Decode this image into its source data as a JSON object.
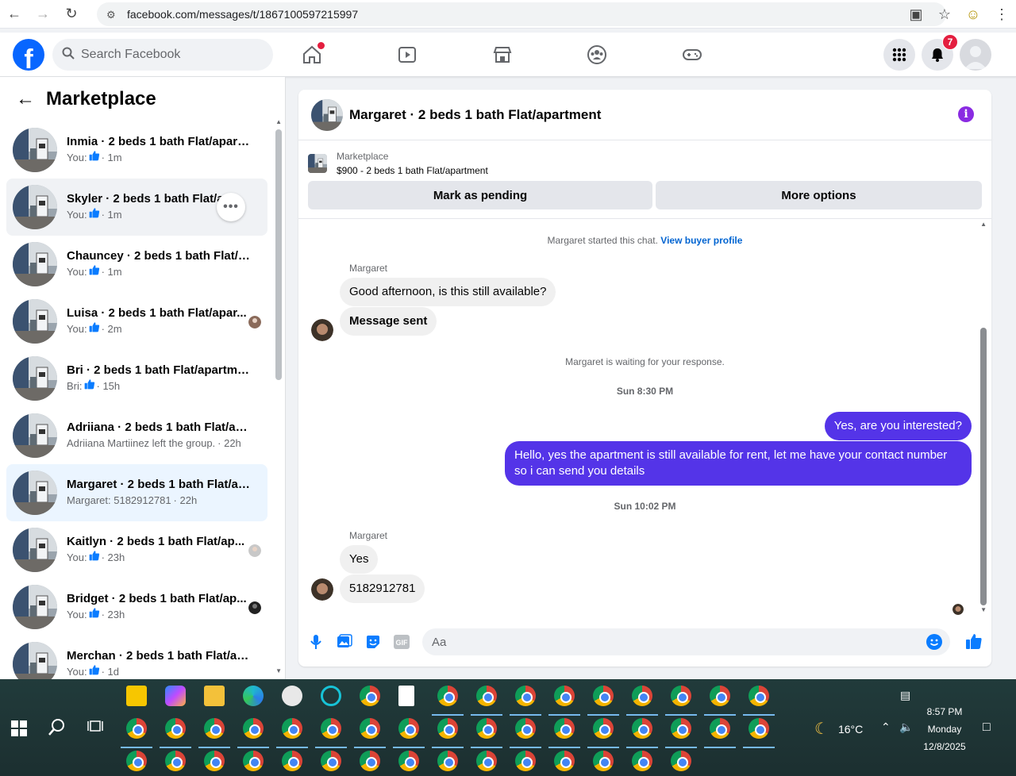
{
  "browser": {
    "url": "facebook.com/messages/t/1867100597215997"
  },
  "header": {
    "search_placeholder": "Search Facebook",
    "notification_count": "7"
  },
  "sidebar": {
    "title": "Marketplace",
    "conversations": [
      {
        "title": "Inmia · 2 beds 1 bath Flat/apart...",
        "prefix": "You:",
        "time": "· 1m",
        "like": true
      },
      {
        "title": "Skyler · 2 beds 1 bath Flat/ap...",
        "prefix": "You:",
        "time": "· 1m",
        "like": true
      },
      {
        "title": "Chauncey · 2 beds 1 bath Flat/ap...",
        "prefix": "You:",
        "time": "· 1m",
        "like": true
      },
      {
        "title": "Luisa · 2 beds 1 bath Flat/apar...",
        "prefix": "You:",
        "time": "· 2m",
        "like": true
      },
      {
        "title": "Bri · 2 beds 1 bath Flat/apartment",
        "prefix": "Bri:",
        "time": "· 15h",
        "like": true
      },
      {
        "title": "Adriiana · 2 beds 1 bath Flat/apa...",
        "prefix": "Adriiana Martiinez left the group.",
        "time": "· 22h",
        "like": false
      },
      {
        "title": "Margaret · 2 beds 1 bath Flat/ap...",
        "prefix": "Margaret: 5182912781",
        "time": "· 22h",
        "like": false
      },
      {
        "title": "Kaitlyn · 2 beds 1 bath Flat/ap...",
        "prefix": "You:",
        "time": "· 23h",
        "like": true
      },
      {
        "title": "Bridget · 2 beds 1 bath Flat/ap...",
        "prefix": "You:",
        "time": "· 23h",
        "like": true
      },
      {
        "title": "Merchan · 2 beds 1 bath Flat/ap...",
        "prefix": "You:",
        "time": "· 1d",
        "like": true
      }
    ]
  },
  "chat": {
    "title": "Margaret · 2 beds 1 bath Flat/apartment",
    "listing_source": "Marketplace",
    "listing_title": "$900 - 2 beds 1 bath Flat/apartment",
    "mark_pending_label": "Mark as pending",
    "more_options_label": "More options",
    "started_text": "Margaret started this chat.",
    "view_profile_label": "View buyer profile",
    "sender_name": "Margaret",
    "msg_1": "Good afternoon, is this still available?",
    "msg_2": "Message sent",
    "waiting_text": "Margaret is waiting for your response.",
    "time_1": "Sun 8:30 PM",
    "out_1": "Yes, are you interested?",
    "out_2": "Hello, yes the apartment is still available for rent, let me have your contact number so i can send you details",
    "time_2": "Sun 10:02 PM",
    "msg_3": "Yes",
    "msg_4": "5182912781",
    "composer_placeholder": "Aa"
  },
  "taskbar": {
    "temperature": "16°C",
    "time": "8:57 PM",
    "day": "Monday",
    "date": "12/8/2025"
  },
  "colors": {
    "fb_blue": "#0866ff",
    "outgoing_bubble": "#5434e8",
    "active_conv": "#ebf5ff",
    "info_icon": "#8a2be2"
  }
}
